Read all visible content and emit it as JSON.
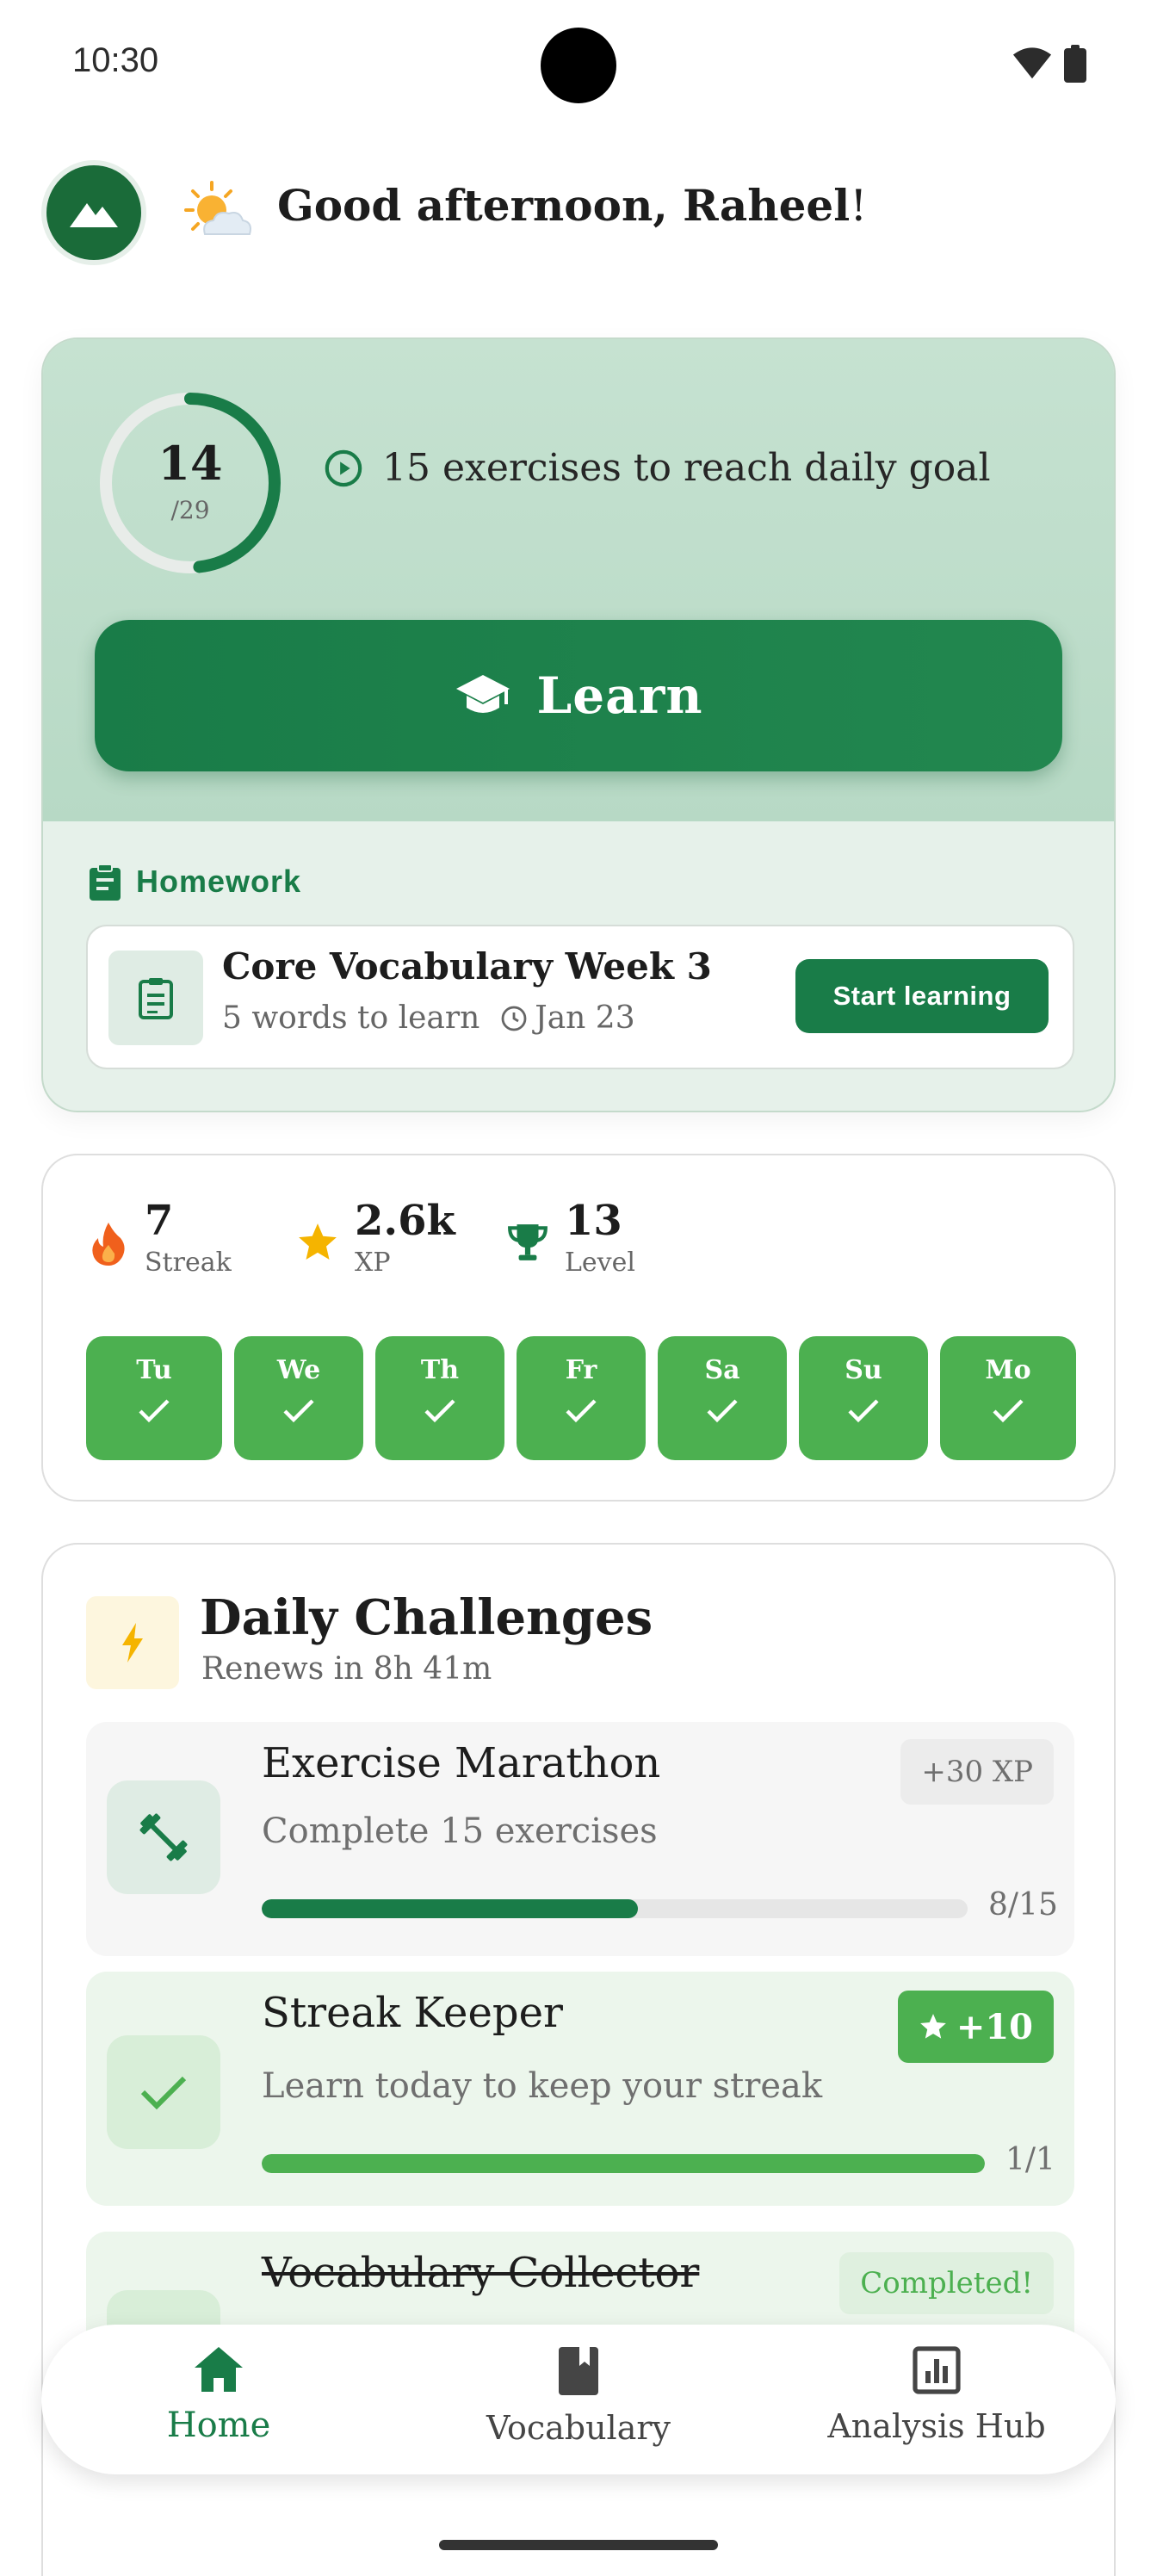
{
  "status_bar": {
    "time": "10:30"
  },
  "header": {
    "greeting": "Good afternoon, Raheel",
    "greeting_suffix": "!"
  },
  "daily_goal": {
    "completed": "14",
    "total": "/29",
    "progress_fraction": 0.4828,
    "message": "15 exercises to reach daily goal",
    "learn_label": "Learn"
  },
  "homework": {
    "section_label": "Homework",
    "title": "Core Vocabulary Week 3",
    "words": "5 words to learn",
    "due": "Jan 23",
    "button_label": "Start learning"
  },
  "stats": [
    {
      "value": "7",
      "label": "Streak",
      "icon": "fire-icon"
    },
    {
      "value": "2.6k",
      "label": "XP",
      "icon": "star-icon"
    },
    {
      "value": "13",
      "label": "Level",
      "icon": "trophy-icon"
    }
  ],
  "days": [
    "Tu",
    "We",
    "Th",
    "Fr",
    "Sa",
    "Su",
    "Mo"
  ],
  "challenges": {
    "title": "Daily Challenges",
    "renews": "Renews in 8h 41m",
    "items": [
      {
        "title": "Exercise Marathon",
        "description": "Complete 15 exercises",
        "reward": "+30 XP",
        "progress_label": "8/15",
        "progress": 0.5333,
        "status": "in-progress"
      },
      {
        "title": "Streak Keeper",
        "description": "Learn today to keep your streak",
        "reward": "+10",
        "progress_label": "1/1",
        "progress": 1.0,
        "status": "done"
      },
      {
        "title": "Vocabulary Collector",
        "badge": "Completed!",
        "status": "completed"
      }
    ]
  },
  "nav": [
    {
      "label": "Home",
      "active": true
    },
    {
      "label": "Vocabulary",
      "active": false
    },
    {
      "label": "Analysis Hub",
      "active": false
    }
  ],
  "colors": {
    "primary": "#197c48",
    "success": "#4cb050",
    "accent_yellow": "#f5b400",
    "fire": "#f0601c"
  }
}
